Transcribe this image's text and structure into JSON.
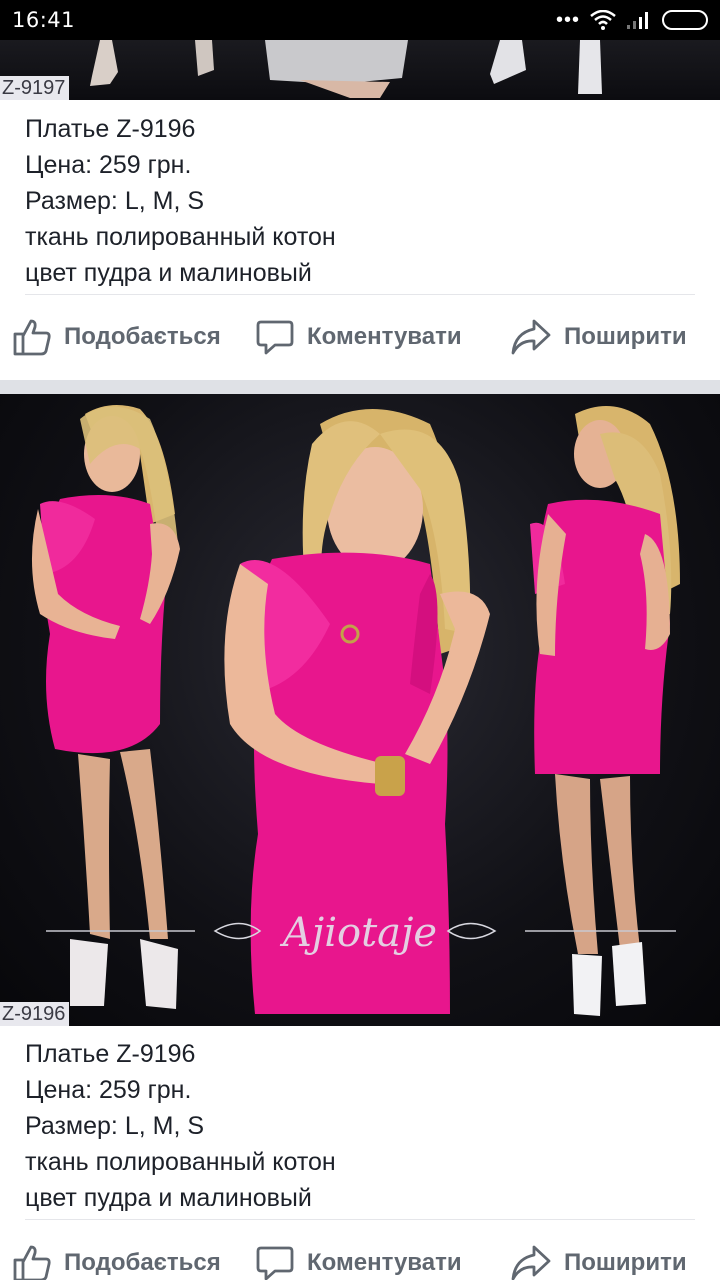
{
  "status_bar": {
    "time": "16:41",
    "dots": "•••"
  },
  "posts": [
    {
      "code": "Z-9197",
      "caption_lines": [
        "Платье Z-9196",
        "Цена: 259 грн.",
        "Размер: L, M, S",
        "ткань полированный котон",
        "цвет пудра и малиновый"
      ],
      "actions": {
        "like": "Подобається",
        "comment": "Коментувати",
        "share": "Поширити"
      }
    },
    {
      "code": "Z-9196",
      "watermark": "Ajiotaje",
      "caption_lines": [
        "Платье Z-9196",
        "Цена: 259 грн.",
        "Размер: L, M, S",
        "ткань полированный котон",
        "цвет пудра и малиновый"
      ],
      "actions": {
        "like": "Подобається",
        "comment": "Коментувати",
        "share": "Поширити"
      }
    }
  ],
  "colors": {
    "dress": "#e8168d",
    "action_text": "#606770",
    "separator": "#dfe1e6"
  }
}
